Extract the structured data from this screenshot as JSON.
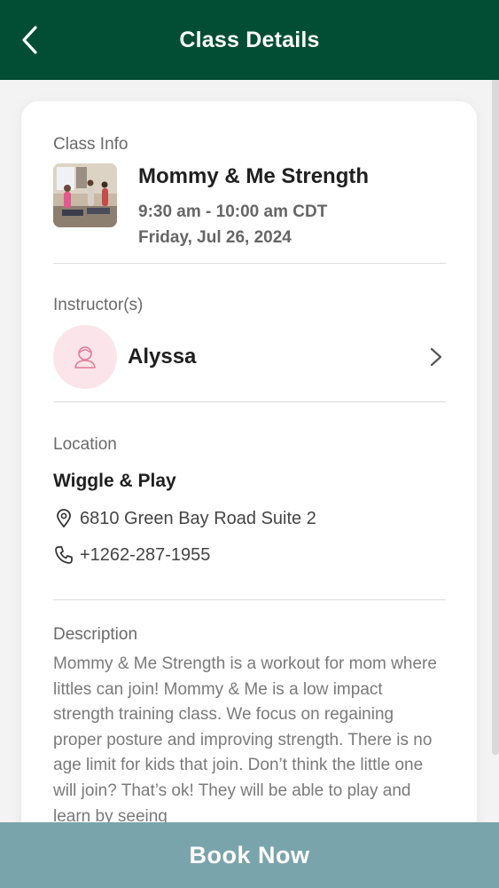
{
  "header": {
    "title": "Class Details"
  },
  "class_info": {
    "section_label": "Class Info",
    "name": "Mommy & Me Strength",
    "time": "9:30 am - 10:00 am CDT",
    "date": "Friday, Jul 26, 2024"
  },
  "instructors": {
    "section_label": "Instructor(s)",
    "items": [
      {
        "name": "Alyssa"
      }
    ]
  },
  "location": {
    "section_label": "Location",
    "name": "Wiggle & Play",
    "address": "6810 Green Bay Road Suite 2",
    "phone": "+1262-287-1955"
  },
  "description": {
    "section_label": "Description",
    "text": "Mommy & Me Strength is a workout for mom where littles can join! Mommy & Me is a low impact strength training class. We focus on regaining proper posture and improving strength. There is no age limit for kids that join. Don’t think the little one will join? That’s ok! They will be able to play and learn by seeing"
  },
  "footer": {
    "book_label": "Book Now"
  },
  "icons": {
    "back": "chevron-left-icon",
    "instructor_avatar": "person-icon",
    "instructor_chevron": "chevron-right-icon",
    "address": "map-pin-icon",
    "phone": "phone-icon"
  },
  "colors": {
    "header_bg": "#024e34",
    "book_bar_bg": "#7aa4ab",
    "avatar_bg": "#fbe4ea",
    "avatar_icon": "#e07a96"
  }
}
